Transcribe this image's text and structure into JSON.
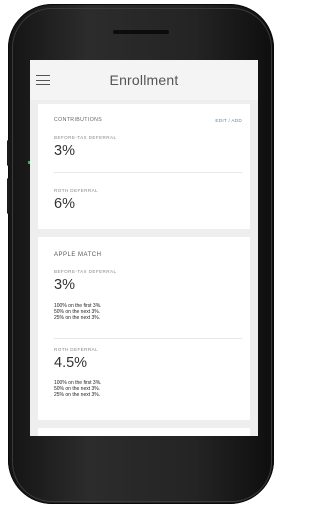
{
  "header": {
    "title": "Enrollment"
  },
  "contributions": {
    "title": "CONTRIBUTIONS",
    "edit_label": "EDIT / ADD",
    "before_tax_label": "BEFORE-TAX DEFERRAL",
    "before_tax_value": "3%",
    "roth_label": "ROTH DEFERRAL",
    "roth_value": "6%"
  },
  "apple_match": {
    "title": "APPLE MATCH",
    "before_tax_label": "BEFORE-TAX DEFERRAL",
    "before_tax_value": "3%",
    "before_tax_notes": [
      "100% on the first 3%.",
      "50% on the next 3%.",
      "25% on the next 3%."
    ],
    "roth_label": "ROTH DEFERRAL",
    "roth_value": "4.5%",
    "roth_notes": [
      "100% on the first 3%.",
      "50% on the next 3%.",
      "25% on the next 3%."
    ]
  }
}
